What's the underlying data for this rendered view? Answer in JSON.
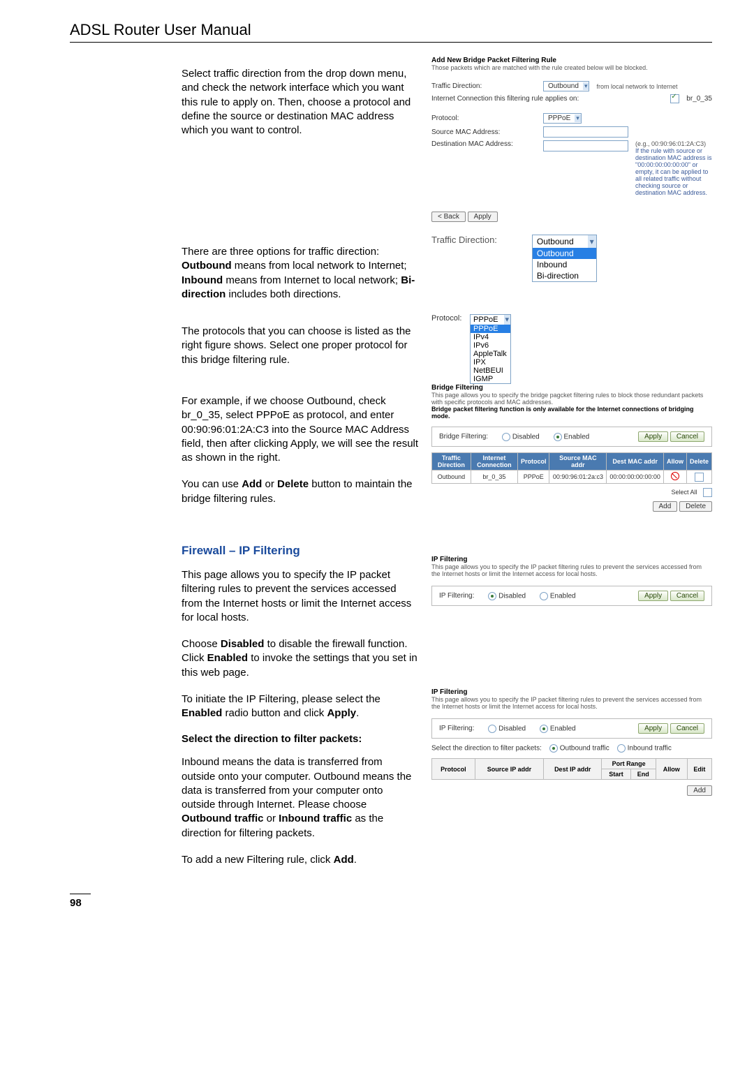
{
  "header": {
    "title": "ADSL Router User Manual"
  },
  "page_number": "98",
  "left": {
    "p1": "Select traffic direction from the drop down menu, and check the network interface which you want this rule to apply on. Then, choose a protocol and define the source or destination MAC address which you want to control.",
    "p2_pre": "There are three options for traffic direction: ",
    "p2_b1": "Outbound",
    "p2_mid1": " means from local network to Internet; ",
    "p2_b2": "Inbound",
    "p2_mid2": " means from Internet to local network; ",
    "p2_b3": "Bi-direction",
    "p2_end": " includes both directions.",
    "p3": "The protocols that you can choose is listed as the right figure shows. Select one proper protocol for this bridge filtering rule.",
    "p4_pre": "For example, if we choose Outbound, check br_0_35, select PPPoE as protocol, and enter 00:90:96:01:2A:C3 into the Source MAC Address field, then after clicking Apply, we will see the result as shown in the right.",
    "p5_pre": "You can use ",
    "p5_b1": "Add",
    "p5_mid": " or ",
    "p5_b2": "Delete",
    "p5_end": " button to maintain the bridge filtering rules.",
    "sec_heading": "Firewall – IP Filtering",
    "p6": "This page allows you to specify the IP packet filtering rules to prevent the services accessed from the Internet hosts or limit the Internet access for local hosts.",
    "p7_pre": "Choose ",
    "p7_b1": "Disabled",
    "p7_mid1": " to disable the firewall function. Click ",
    "p7_b2": "Enabled",
    "p7_end": " to invoke the settings that you set in this web page.",
    "p8_pre": "To initiate the IP Filtering, please select the ",
    "p8_b1": "Enabled",
    "p8_mid": " radio button and click ",
    "p8_b2": "Apply",
    "p8_end": ".",
    "sub_heading": "Select the direction to filter packets:",
    "p9_pre": "Inbound means the data is transferred from outside onto your computer. Outbound means the data is transferred from your computer onto outside through Internet. Please choose ",
    "p9_b1": "Outbound traffic",
    "p9_mid": " or ",
    "p9_b2": "Inbound traffic",
    "p9_end": " as the direction for filtering packets.",
    "p10_pre": "To add a new Filtering rule, click ",
    "p10_b1": "Add",
    "p10_end": "."
  },
  "router1": {
    "heading": "Add New Bridge Packet Filtering Rule",
    "note": "Those packets which are matched with the rule created below will be blocked.",
    "traffic_label": "Traffic Direction:",
    "traffic_value": "Outbound",
    "from_note": "from local network to Internet",
    "conn_label": "Internet Connection this filtering rule applies on:",
    "conn_value": "br_0_35",
    "proto_label": "Protocol:",
    "proto_value": "PPPoE",
    "src_label": "Source MAC Address:",
    "dst_label": "Destination MAC Address:",
    "eg": "(e.g., 00:90:96:01:2A:C3)",
    "warn": "If the rule with source or destination MAC address is \"00:00:00:00:00:00\" or empty, it can be applied to all related traffic without checking source or destination MAC address.",
    "back": "< Back",
    "apply": "Apply"
  },
  "traffic_big": {
    "label": "Traffic Direction:",
    "selected": "Outbound",
    "opts": [
      "Outbound",
      "Inbound",
      "Bi-direction"
    ]
  },
  "proto_big": {
    "label": "Protocol:",
    "selected": "PPPoE",
    "opts": [
      "PPPoE",
      "IPv4",
      "IPv6",
      "AppleTalk",
      "IPX",
      "NetBEUI",
      "IGMP"
    ]
  },
  "bridge": {
    "heading": "Bridge Filtering",
    "note1": "This page allows you to specify the bridge pagcket filtering rules to block those redundant packets with specific protocols and MAC addresses.",
    "note2": "Bridge packet filtering function is only available for the Internet connections of bridging mode.",
    "filter_label": "Bridge Filtering:",
    "disabled": "Disabled",
    "enabled": "Enabled",
    "apply": "Apply",
    "cancel": "Cancel",
    "headers": [
      "Traffic Direction",
      "Internet Connection",
      "Protocol",
      "Source MAC addr",
      "Dest MAC addr",
      "Allow",
      "Delete"
    ],
    "row": [
      "Outbound",
      "br_0_35",
      "PPPoE",
      "00:90:96:01:2a:c3",
      "00:00:00:00:00:00"
    ],
    "select_all": "Select All",
    "add": "Add",
    "delete": "Delete"
  },
  "ipf1": {
    "heading": "IP Filtering",
    "note": "This page allows you to specify the IP packet filtering rules to prevent the services accessed from the Internet hosts or limit the Internet access for local hosts.",
    "label": "IP Filtering:",
    "disabled": "Disabled",
    "enabled": "Enabled",
    "apply": "Apply",
    "cancel": "Cancel"
  },
  "ipf2": {
    "heading": "IP Filtering",
    "note": "This page allows you to specify the IP packet filtering rules to prevent the services accessed from the Internet hosts or limit the Internet access for local hosts.",
    "label": "IP Filtering:",
    "disabled": "Disabled",
    "enabled": "Enabled",
    "apply": "Apply",
    "cancel": "Cancel",
    "dir_label": "Select the direction to filter packets:",
    "outbound": "Outbound traffic",
    "inbound": "Inbound traffic",
    "theaders": [
      "Protocol",
      "Source IP addr",
      "Dest IP addr",
      "Port Range",
      "Allow",
      "Edit"
    ],
    "sub_headers": [
      "Start",
      "End"
    ],
    "add": "Add"
  }
}
